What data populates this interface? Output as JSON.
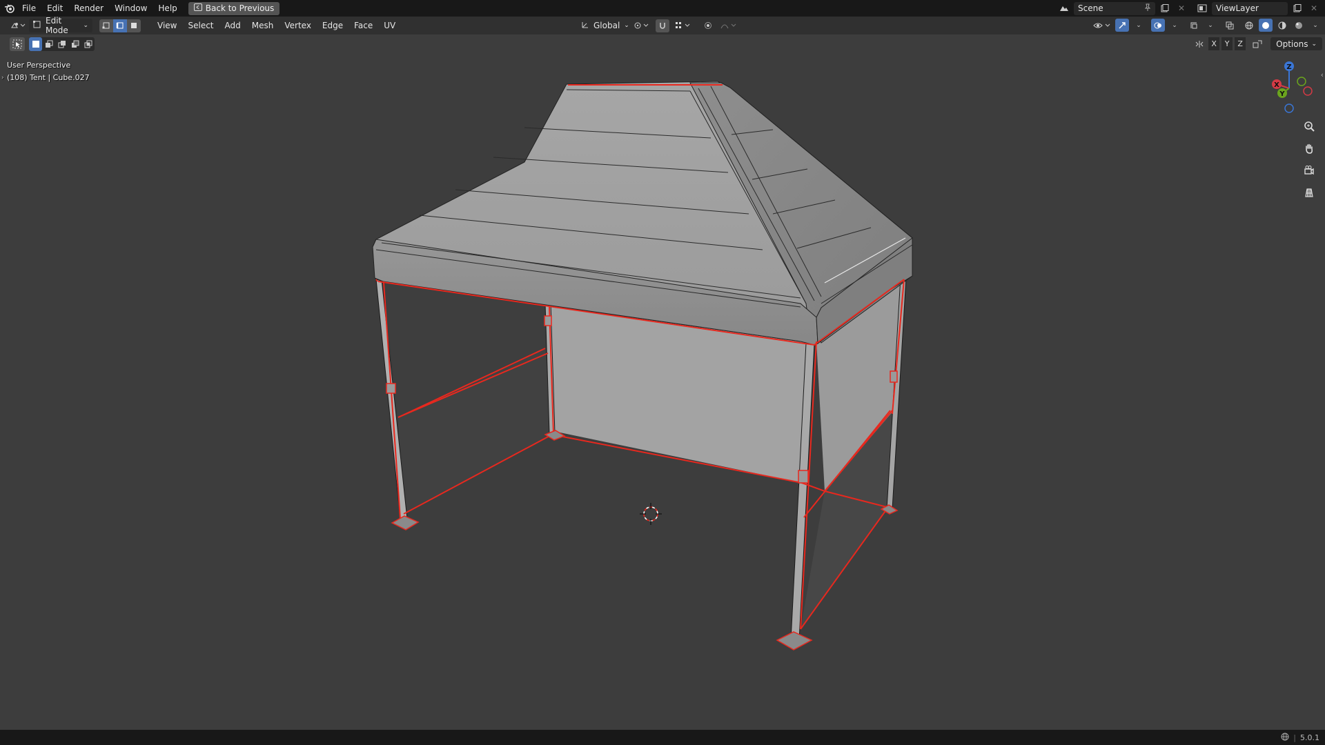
{
  "topbar": {
    "menus": [
      "File",
      "Edit",
      "Render",
      "Window",
      "Help"
    ],
    "back_button": "Back to Previous",
    "scene_name": "Scene",
    "view_layer": "ViewLayer"
  },
  "header": {
    "mode": "Edit Mode",
    "menus": [
      "View",
      "Select",
      "Add",
      "Mesh",
      "Vertex",
      "Edge",
      "Face",
      "UV"
    ],
    "transform_orientation": "Global"
  },
  "axis_toggles": [
    "X",
    "Y",
    "Z"
  ],
  "options_label": "Options",
  "viewport": {
    "perspective": "User Perspective",
    "object_info": "(108) Tent | Cube.027"
  },
  "gizmo": {
    "x_label": "X",
    "y_label": "Y",
    "z_label": "Z"
  },
  "colors": {
    "selection_edge": "#e8281e",
    "gizmo_x": "#d43a45",
    "gizmo_y": "#6ba51d",
    "gizmo_z": "#3a76d6",
    "active_blue": "#4772b3"
  },
  "status": {
    "version": "5.0.1"
  }
}
